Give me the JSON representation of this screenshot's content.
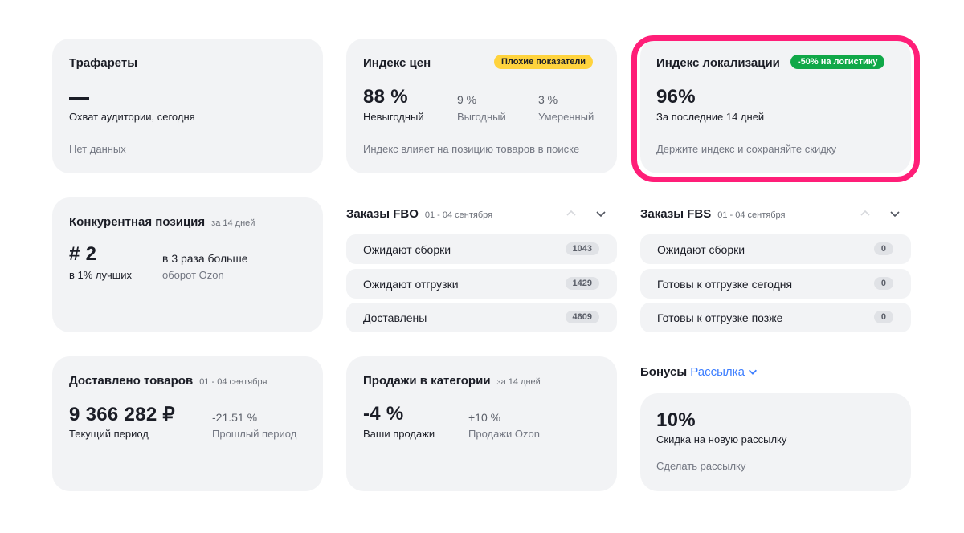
{
  "trafarety": {
    "title": "Трафареты",
    "caption": "Охват аудитории, сегодня",
    "footer": "Нет данных"
  },
  "price_index": {
    "title": "Индекс цен",
    "badge": "Плохие показатели",
    "stats": [
      {
        "value": "88 %",
        "label": "Невыгодный"
      },
      {
        "value": "9 %",
        "label": "Выгодный"
      },
      {
        "value": "3 %",
        "label": "Умеренный"
      }
    ],
    "footer": "Индекс влияет на позицию товаров в поиске"
  },
  "localization": {
    "title": "Индекс локализации",
    "badge": "-50% на логистику",
    "value": "96%",
    "caption": "За последние 14 дней",
    "footer": "Держите индекс и сохраняйте скидку"
  },
  "competition": {
    "title": "Конкурентная позиция",
    "period": "за 14 дней",
    "value": "# 2",
    "value_caption": "в 1% лучших",
    "compare": "в 3 раза больше",
    "compare_caption": "оборот Ozon"
  },
  "fbo": {
    "title": "Заказы FBO",
    "period": "01 - 04 сентября",
    "rows": [
      {
        "label": "Ожидают сборки",
        "count": "1043"
      },
      {
        "label": "Ожидают отгрузки",
        "count": "1429"
      },
      {
        "label": "Доставлены",
        "count": "4609"
      }
    ]
  },
  "fbs": {
    "title": "Заказы FBS",
    "period": "01 - 04 сентября",
    "rows": [
      {
        "label": "Ожидают сборки",
        "count": "0"
      },
      {
        "label": "Готовы к отгрузке сегодня",
        "count": "0"
      },
      {
        "label": "Готовы к отгрузке позже",
        "count": "0"
      }
    ]
  },
  "delivered": {
    "title": "Доставлено товаров",
    "period": "01 - 04 сентября",
    "value": "9 366 282 ₽",
    "value_caption": "Текущий период",
    "prev": "-21.51 %",
    "prev_caption": "Прошлый период"
  },
  "category_sales": {
    "title": "Продажи в категории",
    "period": "за 14 дней",
    "value": "-4 %",
    "value_caption": "Ваши продажи",
    "ozon": "+10 %",
    "ozon_caption": "Продажи Ozon"
  },
  "bonuses": {
    "title": "Бонусы",
    "link": "Рассылка",
    "value": "10%",
    "caption": "Скидка на новую рассылку",
    "action": "Сделать рассылку"
  },
  "colors": {
    "highlight": "#ff1e78",
    "badge_yellow": "#ffd33d",
    "badge_green": "#10a848",
    "link": "#3d7eff"
  }
}
